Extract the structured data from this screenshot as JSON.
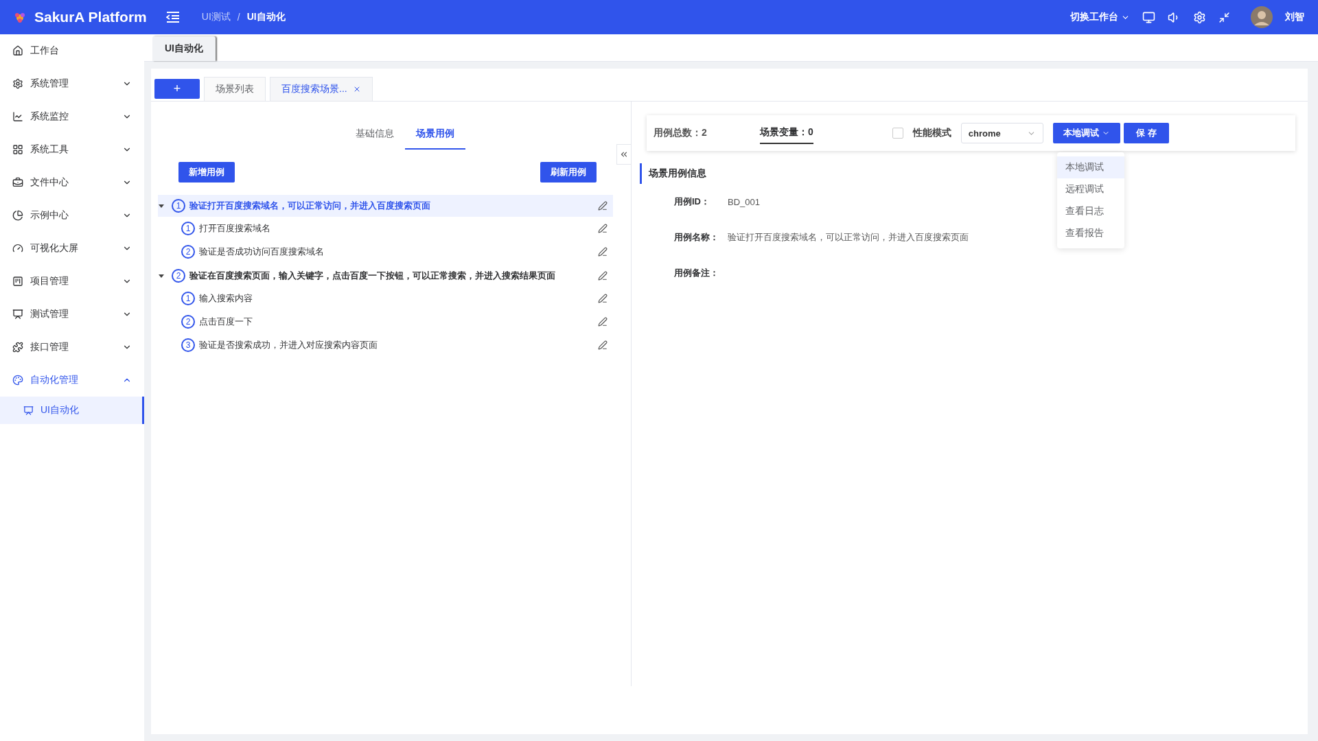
{
  "header": {
    "logo": "SakurA Platform",
    "breadcrumb": [
      "UI测试",
      "UI自动化"
    ],
    "separator": "/",
    "workspace": {
      "label": "切换工作台",
      "expanded": false
    },
    "user": "刘智"
  },
  "sidebar": {
    "items": [
      {
        "label": "工作台",
        "selected": false
      },
      {
        "label": "系统管理",
        "selected": false,
        "expanded": false
      },
      {
        "label": "系统监控",
        "selected": false,
        "expanded": false
      },
      {
        "label": "系统工具",
        "selected": false,
        "expanded": false
      },
      {
        "label": "文件中心",
        "selected": false,
        "expanded": false
      },
      {
        "label": "示例中心",
        "selected": false,
        "expanded": false
      },
      {
        "label": "可视化大屏",
        "selected": false,
        "expanded": false
      },
      {
        "label": "项目管理",
        "selected": false,
        "expanded": false
      },
      {
        "label": "测试管理",
        "selected": false,
        "expanded": false
      },
      {
        "label": "接口管理",
        "selected": false,
        "expanded": false
      },
      {
        "label": "自动化管理",
        "selected": true,
        "expanded": true,
        "children": [
          {
            "label": "UI自动化",
            "selected": true
          }
        ]
      }
    ]
  },
  "page_tabs": [
    {
      "label": "UI自动化",
      "selected": true
    }
  ],
  "sub_tabs": [
    {
      "kind": "add",
      "label": "+",
      "selected": false
    },
    {
      "kind": "tab",
      "label": "场景列表",
      "selected": false
    },
    {
      "kind": "tab",
      "label": "百度搜索场景...",
      "selected": true,
      "closable": true
    }
  ],
  "inner_tabs": [
    {
      "label": "基础信息",
      "selected": false
    },
    {
      "label": "场景用例",
      "selected": true
    }
  ],
  "actions": {
    "add": "新增用例",
    "refresh": "刷新用例"
  },
  "cases": [
    {
      "number": "1",
      "title": "验证打开百度搜索域名，可以正常访问，并进入百度搜索页面",
      "selected": true,
      "expanded": true,
      "children": [
        {
          "number": "1",
          "title": "打开百度搜索域名"
        },
        {
          "number": "2",
          "title": "验证是否成功访问百度搜索域名"
        }
      ]
    },
    {
      "number": "2",
      "title": "验证在百度搜索页面，输入关键字，点击百度一下按钮，可以正常搜索，并进入搜索结果页面",
      "selected": false,
      "expanded": true,
      "children": [
        {
          "number": "1",
          "title": "输入搜索内容"
        },
        {
          "number": "2",
          "title": "点击百度一下"
        },
        {
          "number": "3",
          "title": "验证是否搜索成功，并进入对应搜索内容页面"
        }
      ]
    }
  ],
  "toolbar": {
    "case_total": "用例总数：2",
    "scene_vars": "场景变量：0",
    "perf_mode": {
      "label": "性能模式",
      "checked": false
    },
    "browser": "chrome",
    "run": "本地调试",
    "save": "保 存",
    "menu": [
      {
        "label": "本地调试",
        "selected": true
      },
      {
        "label": "远程调试",
        "selected": false
      },
      {
        "label": "查看日志",
        "selected": false
      },
      {
        "label": "查看报告",
        "selected": false
      }
    ]
  },
  "details": {
    "title": "场景用例信息",
    "fields": [
      {
        "label": "用例ID：",
        "value": "BD_001"
      },
      {
        "label": "用例名称：",
        "value": "验证打开百度搜索域名，可以正常访问，并进入百度搜索页面"
      },
      {
        "label": "用例备注："
      }
    ]
  }
}
